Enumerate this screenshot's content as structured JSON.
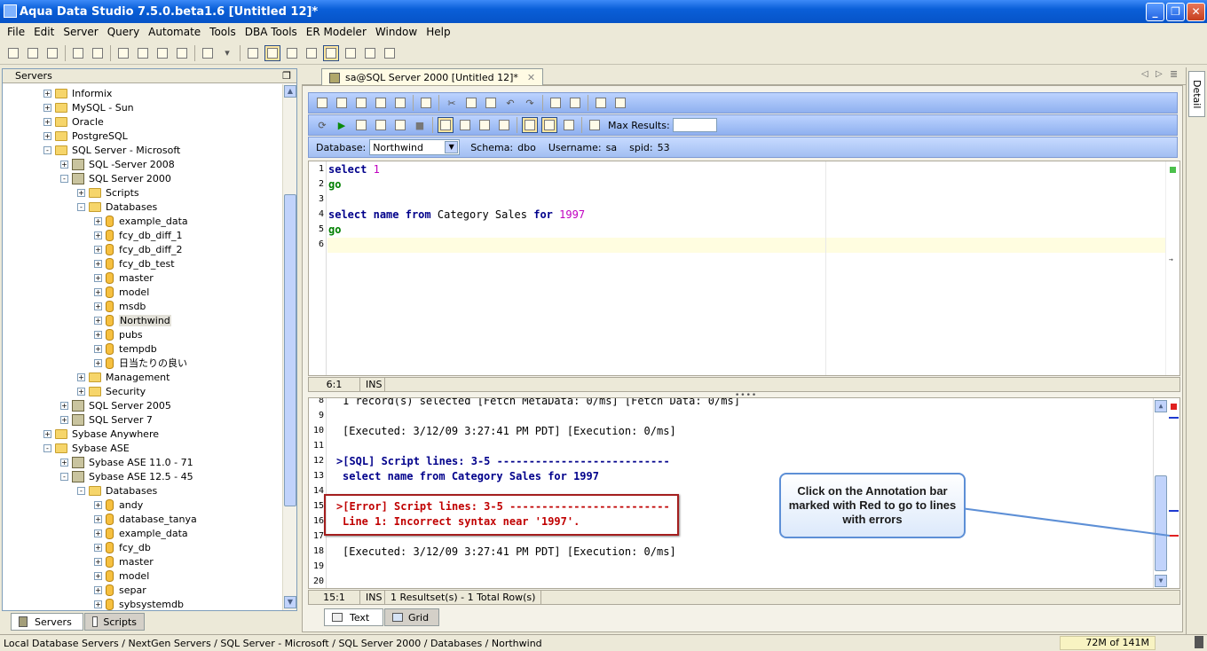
{
  "window": {
    "title": "Aqua Data Studio 7.5.0.beta1.6 [Untitled 12]*",
    "min": "_",
    "max": "❐",
    "close": "✕"
  },
  "menu": [
    "File",
    "Edit",
    "Server",
    "Query",
    "Automate",
    "Tools",
    "DBA Tools",
    "ER Modeler",
    "Window",
    "Help"
  ],
  "left_panel": {
    "header": "Servers",
    "tree": [
      {
        "label": "Informix",
        "indent": 0,
        "icon": "folder",
        "pm": "+"
      },
      {
        "label": "MySQL - Sun",
        "indent": 0,
        "icon": "folder",
        "pm": "+"
      },
      {
        "label": "Oracle",
        "indent": 0,
        "icon": "folder",
        "pm": "+"
      },
      {
        "label": "PostgreSQL",
        "indent": 0,
        "icon": "folder",
        "pm": "+"
      },
      {
        "label": "SQL Server - Microsoft",
        "indent": 0,
        "icon": "folder",
        "pm": "-"
      },
      {
        "label": "SQL -Server 2008",
        "indent": 1,
        "icon": "server",
        "pm": "+"
      },
      {
        "label": "SQL Server 2000",
        "indent": 1,
        "icon": "server",
        "pm": "-"
      },
      {
        "label": "Scripts",
        "indent": 2,
        "icon": "folder",
        "pm": "+"
      },
      {
        "label": "Databases",
        "indent": 2,
        "icon": "folder",
        "pm": "-"
      },
      {
        "label": "example_data",
        "indent": 3,
        "icon": "db",
        "pm": "+"
      },
      {
        "label": "fcy_db_diff_1",
        "indent": 3,
        "icon": "db",
        "pm": "+"
      },
      {
        "label": "fcy_db_diff_2",
        "indent": 3,
        "icon": "db",
        "pm": "+"
      },
      {
        "label": "fcy_db_test",
        "indent": 3,
        "icon": "db",
        "pm": "+"
      },
      {
        "label": "master",
        "indent": 3,
        "icon": "db",
        "pm": "+"
      },
      {
        "label": "model",
        "indent": 3,
        "icon": "db",
        "pm": "+"
      },
      {
        "label": "msdb",
        "indent": 3,
        "icon": "db",
        "pm": "+"
      },
      {
        "label": "Northwind",
        "indent": 3,
        "icon": "db",
        "pm": "+",
        "selected": true
      },
      {
        "label": "pubs",
        "indent": 3,
        "icon": "db",
        "pm": "+"
      },
      {
        "label": "tempdb",
        "indent": 3,
        "icon": "db",
        "pm": "+"
      },
      {
        "label": "日当たりの良い",
        "indent": 3,
        "icon": "db",
        "pm": "+"
      },
      {
        "label": "Management",
        "indent": 2,
        "icon": "folder",
        "pm": "+"
      },
      {
        "label": "Security",
        "indent": 2,
        "icon": "folder",
        "pm": "+"
      },
      {
        "label": "SQL Server 2005",
        "indent": 1,
        "icon": "server",
        "pm": "+"
      },
      {
        "label": "SQL Server 7",
        "indent": 1,
        "icon": "server",
        "pm": "+"
      },
      {
        "label": "Sybase Anywhere",
        "indent": 0,
        "icon": "folder",
        "pm": "+"
      },
      {
        "label": "Sybase ASE",
        "indent": 0,
        "icon": "folder",
        "pm": "-"
      },
      {
        "label": "Sybase ASE 11.0 - 71",
        "indent": 1,
        "icon": "server",
        "pm": "+"
      },
      {
        "label": "Sybase ASE 12.5 - 45",
        "indent": 1,
        "icon": "server",
        "pm": "-"
      },
      {
        "label": "Databases",
        "indent": 2,
        "icon": "folder",
        "pm": "-"
      },
      {
        "label": "andy",
        "indent": 3,
        "icon": "db",
        "pm": "+"
      },
      {
        "label": "database_tanya",
        "indent": 3,
        "icon": "db",
        "pm": "+"
      },
      {
        "label": "example_data",
        "indent": 3,
        "icon": "db",
        "pm": "+"
      },
      {
        "label": "fcy_db",
        "indent": 3,
        "icon": "db",
        "pm": "+"
      },
      {
        "label": "master",
        "indent": 3,
        "icon": "db",
        "pm": "+"
      },
      {
        "label": "model",
        "indent": 3,
        "icon": "db",
        "pm": "+"
      },
      {
        "label": "separ",
        "indent": 3,
        "icon": "db",
        "pm": "+"
      },
      {
        "label": "sybsystemdb",
        "indent": 3,
        "icon": "db",
        "pm": "+"
      }
    ],
    "tabs": [
      "Servers",
      "Scripts"
    ]
  },
  "doc_tab": "sa@SQL Server 2000 [Untitled 12]*",
  "side_tab": "Detail",
  "query_toolbar": {
    "max_results_label": "Max Results:",
    "max_results_value": "",
    "database_label": "Database:",
    "database_value": "Northwind",
    "schema_label": "Schema:",
    "schema_value": "dbo",
    "username_label": "Username:",
    "username_value": "sa",
    "spid_label": "spid:",
    "spid_value": "53"
  },
  "editor": {
    "line_numbers": [
      "1",
      "2",
      "3",
      "4",
      "5",
      "6"
    ],
    "status": {
      "pos": "6:1",
      "mode": "INS"
    }
  },
  "output": {
    "line_numbers": [
      "8",
      "9",
      "10",
      "11",
      "12",
      "13",
      "14",
      "15",
      "16",
      "17",
      "18",
      "19",
      "20"
    ],
    "lines": [
      "1 record(s) selected [Fetch MetaData: 0/ms] [Fetch Data: 0/ms]",
      "",
      "[Executed: 3/12/09 3:27:41 PM PDT] [Execution: 0/ms]",
      "",
      ">[SQL] Script lines: 3-5 ---------------------------",
      "select name from Category Sales for 1997",
      "",
      ">[Error] Script lines: 3-5 -------------------------",
      "Line 1: Incorrect syntax near '1997'.",
      "",
      "[Executed: 3/12/09 3:27:41 PM PDT] [Execution: 0/ms]",
      "",
      ""
    ],
    "status": {
      "pos": "15:1",
      "mode": "INS",
      "info": "1 Resultset(s) - 1 Total Row(s)"
    },
    "tabs": [
      "Text",
      "Grid"
    ]
  },
  "callout": "Click on the Annotation bar marked with Red to go to lines with errors",
  "statusline": {
    "path": "Local Database Servers / NextGen Servers / SQL Server - Microsoft / SQL Server 2000 / Databases / Northwind",
    "memory": "72M of 141M"
  },
  "colors": {
    "accent": "#0a5fd8",
    "error": "#c00000",
    "keyword": "#00008b"
  }
}
